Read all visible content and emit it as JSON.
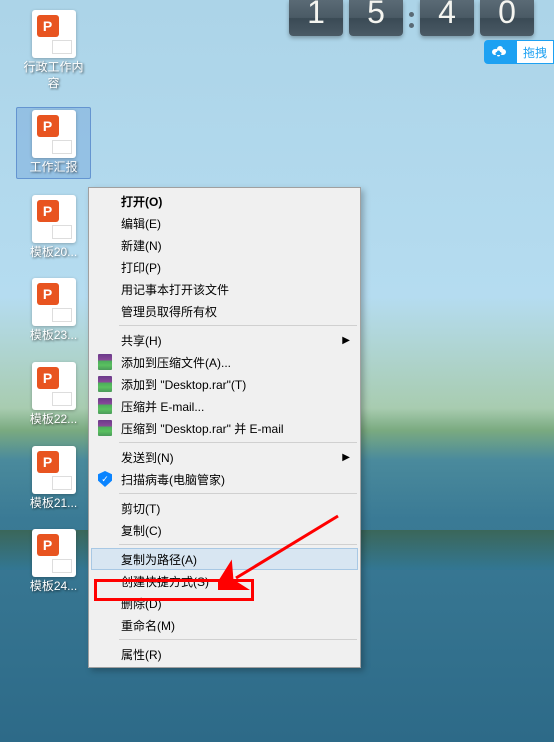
{
  "desktop": {
    "icons": [
      {
        "label": "行政工作内容",
        "selected": false
      },
      {
        "label": "工作汇报",
        "selected": true
      },
      {
        "label": "模板20...",
        "selected": false
      },
      {
        "label": "模板23...",
        "selected": false
      },
      {
        "label": "模板22...",
        "selected": false
      },
      {
        "label": "模板21...",
        "selected": false
      },
      {
        "label": "模板24...",
        "selected": false
      }
    ]
  },
  "clock": {
    "d1": "1",
    "d2": "5",
    "d3": "4",
    "d4": "0"
  },
  "cloud_button": {
    "label": "拖拽"
  },
  "context_menu": {
    "groups": [
      [
        {
          "label": "打开(O)",
          "bold": true
        },
        {
          "label": "编辑(E)"
        },
        {
          "label": "新建(N)"
        },
        {
          "label": "打印(P)"
        },
        {
          "label": "用记事本打开该文件"
        },
        {
          "label": "管理员取得所有权"
        }
      ],
      [
        {
          "label": "共享(H)",
          "submenu": true
        },
        {
          "label": "添加到压缩文件(A)...",
          "icon": "rar"
        },
        {
          "label": "添加到 \"Desktop.rar\"(T)",
          "icon": "rar"
        },
        {
          "label": "压缩并 E-mail...",
          "icon": "rar"
        },
        {
          "label": "压缩到 \"Desktop.rar\" 并 E-mail",
          "icon": "rar"
        }
      ],
      [
        {
          "label": "发送到(N)",
          "submenu": true
        },
        {
          "label": "扫描病毒(电脑管家)",
          "icon": "shield"
        }
      ],
      [
        {
          "label": "剪切(T)"
        },
        {
          "label": "复制(C)"
        }
      ],
      [
        {
          "label": "复制为路径(A)",
          "hover": true
        },
        {
          "label": "创建快捷方式(S)"
        },
        {
          "label": "删除(D)"
        },
        {
          "label": "重命名(M)"
        }
      ],
      [
        {
          "label": "属性(R)"
        }
      ]
    ]
  },
  "annotation": {
    "highlight_target": "复制为路径(A)"
  }
}
